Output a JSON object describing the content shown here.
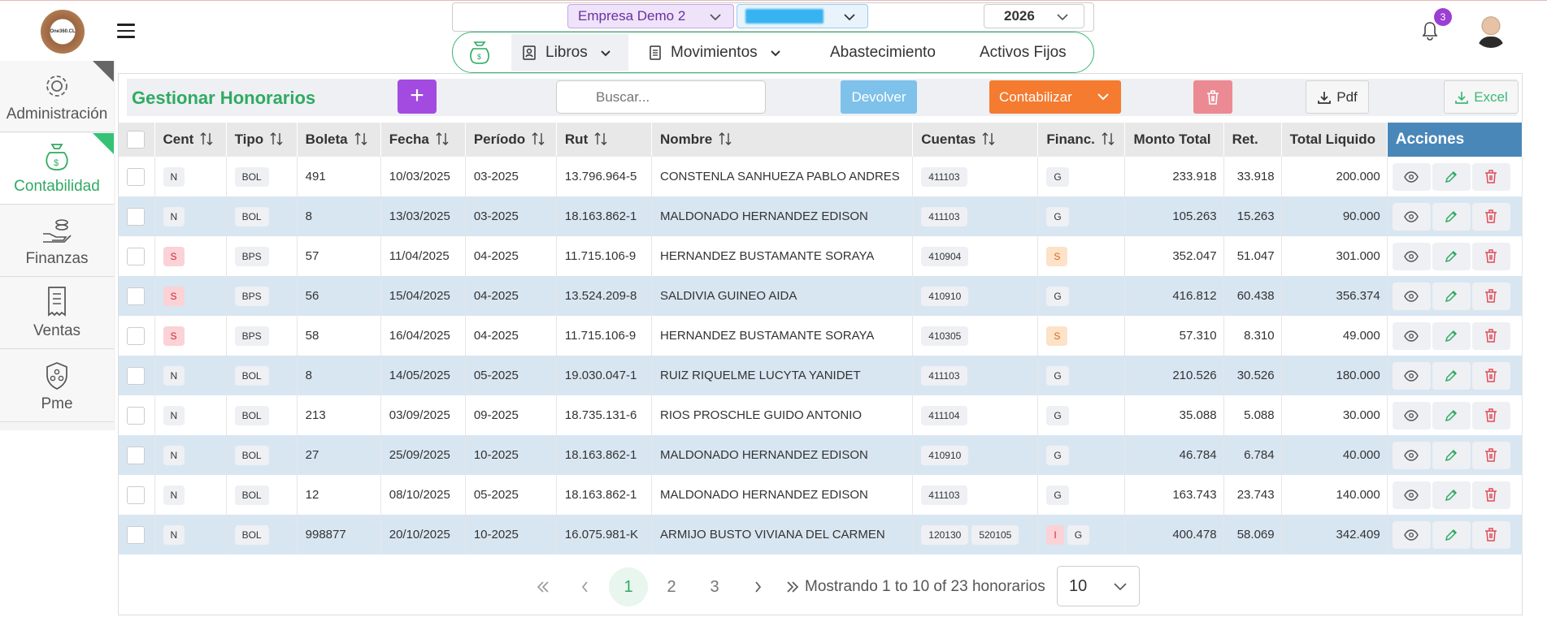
{
  "brand": {
    "logo_text": "One360.CL"
  },
  "header": {
    "empresa": "Empresa Demo 2",
    "year": "2026",
    "notifications_count": "3",
    "nav": [
      {
        "label": "Libros"
      },
      {
        "label": "Movimientos"
      },
      {
        "label": "Abastecimiento"
      },
      {
        "label": "Activos Fijos"
      }
    ]
  },
  "sidebar": {
    "items": [
      {
        "label": "Administración",
        "icon": "gear-icon"
      },
      {
        "label": "Contabilidad",
        "icon": "money-bag-icon"
      },
      {
        "label": "Finanzas",
        "icon": "coins-hand-icon"
      },
      {
        "label": "Ventas",
        "icon": "receipt-icon"
      },
      {
        "label": "Pme",
        "icon": "shield-network-icon"
      }
    ]
  },
  "toolbar": {
    "title": "Gestionar Honorarios",
    "add_label": "+",
    "search_placeholder": "Buscar...",
    "devolver_label": "Devolver",
    "contabilizar_label": "Contabilizar",
    "pdf_label": "Pdf",
    "excel_label": "Excel"
  },
  "table": {
    "columns": [
      "Cent",
      "Tipo",
      "Boleta",
      "Fecha",
      "Período",
      "Rut",
      "Nombre",
      "Cuentas",
      "Financ.",
      "Monto Total",
      "Ret.",
      "Total Liquido",
      "Acciones"
    ],
    "rows": [
      {
        "cent": "N",
        "tipo": "BOL",
        "boleta": "491",
        "fecha": "10/03/2025",
        "periodo": "03-2025",
        "rut": "13.796.964-5",
        "nombre": "CONSTENLA SANHUEZA PABLO ANDRES",
        "cuentas": [
          "411103"
        ],
        "financ": [
          "G"
        ],
        "monto": "233.918",
        "ret": "33.918",
        "liquido": "200.000"
      },
      {
        "cent": "N",
        "tipo": "BOL",
        "boleta": "8",
        "fecha": "13/03/2025",
        "periodo": "03-2025",
        "rut": "18.163.862-1",
        "nombre": "MALDONADO HERNANDEZ EDISON",
        "cuentas": [
          "411103"
        ],
        "financ": [
          "G"
        ],
        "monto": "105.263",
        "ret": "15.263",
        "liquido": "90.000"
      },
      {
        "cent": "S",
        "tipo": "BPS",
        "boleta": "57",
        "fecha": "11/04/2025",
        "periodo": "04-2025",
        "rut": "11.715.106-9",
        "nombre": "HERNANDEZ BUSTAMANTE SORAYA",
        "cuentas": [
          "410904"
        ],
        "financ": [
          "S"
        ],
        "monto": "352.047",
        "ret": "51.047",
        "liquido": "301.000"
      },
      {
        "cent": "S",
        "tipo": "BPS",
        "boleta": "56",
        "fecha": "15/04/2025",
        "periodo": "04-2025",
        "rut": "13.524.209-8",
        "nombre": "SALDIVIA GUINEO AIDA",
        "cuentas": [
          "410910"
        ],
        "financ": [
          "G"
        ],
        "monto": "416.812",
        "ret": "60.438",
        "liquido": "356.374"
      },
      {
        "cent": "S",
        "tipo": "BPS",
        "boleta": "58",
        "fecha": "16/04/2025",
        "periodo": "04-2025",
        "rut": "11.715.106-9",
        "nombre": "HERNANDEZ BUSTAMANTE SORAYA",
        "cuentas": [
          "410305"
        ],
        "financ": [
          "S"
        ],
        "monto": "57.310",
        "ret": "8.310",
        "liquido": "49.000"
      },
      {
        "cent": "N",
        "tipo": "BOL",
        "boleta": "8",
        "fecha": "14/05/2025",
        "periodo": "05-2025",
        "rut": "19.030.047-1",
        "nombre": "RUIZ RIQUELME LUCYTA YANIDET",
        "cuentas": [
          "411103"
        ],
        "financ": [
          "G"
        ],
        "monto": "210.526",
        "ret": "30.526",
        "liquido": "180.000"
      },
      {
        "cent": "N",
        "tipo": "BOL",
        "boleta": "213",
        "fecha": "03/09/2025",
        "periodo": "09-2025",
        "rut": "18.735.131-6",
        "nombre": "RIOS PROSCHLE GUIDO ANTONIO",
        "cuentas": [
          "411104"
        ],
        "financ": [
          "G"
        ],
        "monto": "35.088",
        "ret": "5.088",
        "liquido": "30.000"
      },
      {
        "cent": "N",
        "tipo": "BOL",
        "boleta": "27",
        "fecha": "25/09/2025",
        "periodo": "10-2025",
        "rut": "18.163.862-1",
        "nombre": "MALDONADO HERNANDEZ EDISON",
        "cuentas": [
          "410910"
        ],
        "financ": [
          "G"
        ],
        "monto": "46.784",
        "ret": "6.784",
        "liquido": "40.000"
      },
      {
        "cent": "N",
        "tipo": "BOL",
        "boleta": "12",
        "fecha": "08/10/2025",
        "periodo": "05-2025",
        "rut": "18.163.862-1",
        "nombre": "MALDONADO HERNANDEZ EDISON",
        "cuentas": [
          "411103"
        ],
        "financ": [
          "G"
        ],
        "monto": "163.743",
        "ret": "23.743",
        "liquido": "140.000"
      },
      {
        "cent": "N",
        "tipo": "BOL",
        "boleta": "998877",
        "fecha": "20/10/2025",
        "periodo": "10-2025",
        "rut": "16.075.981-K",
        "nombre": "ARMIJO BUSTO VIVIANA DEL CARMEN",
        "cuentas": [
          "120130",
          "520105"
        ],
        "financ": [
          "I",
          "G"
        ],
        "monto": "400.478",
        "ret": "58.069",
        "liquido": "342.409"
      }
    ]
  },
  "pagination": {
    "pages": [
      "1",
      "2",
      "3"
    ],
    "current": "1",
    "info": "Mostrando 1 to 10 of 23 honorarios",
    "page_size": "10"
  },
  "colors": {
    "brand_green": "#2faa62",
    "purple": "#a34be0",
    "orange": "#f47b2f",
    "header_blue": "#4a87b9",
    "row_alt": "#d8e6f2"
  }
}
